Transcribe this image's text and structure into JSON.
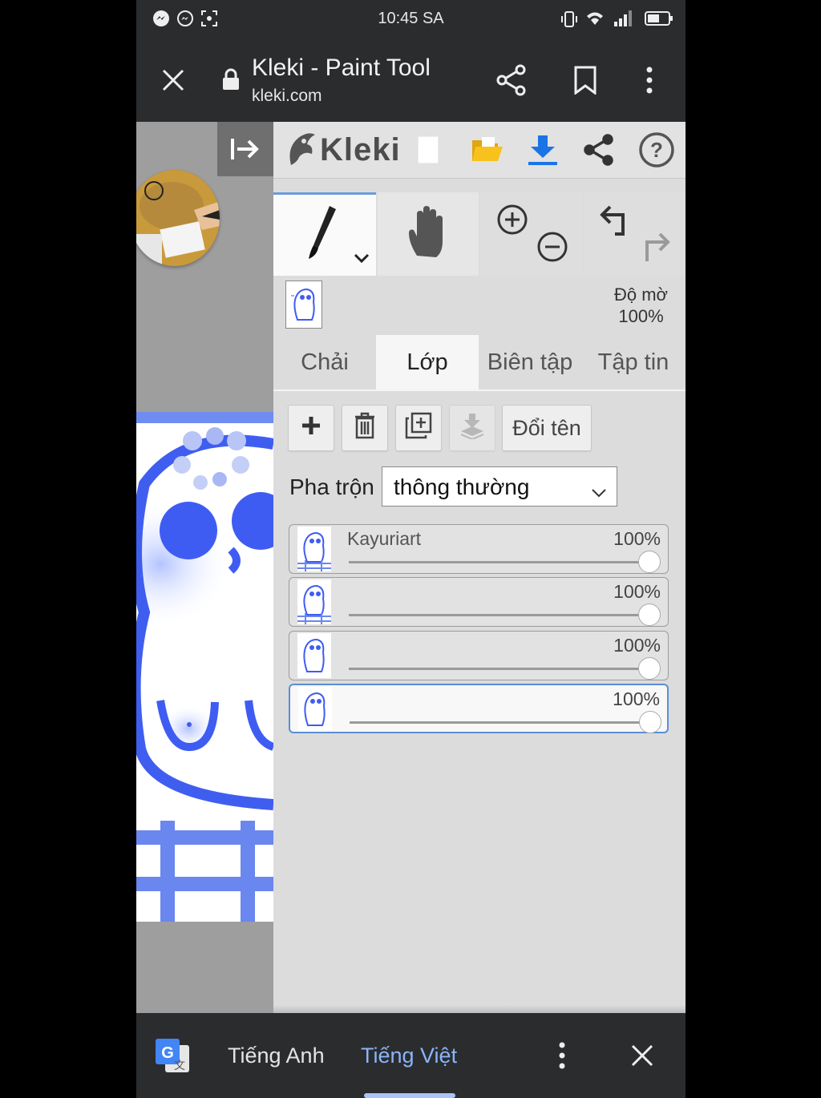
{
  "status_bar": {
    "time": "10:45 SA",
    "left_icons": [
      "messenger-icon",
      "messenger-icon",
      "screenshot-icon"
    ],
    "right_icons": [
      "vibrate-icon",
      "wifi-icon",
      "signal-icon",
      "battery-icon"
    ]
  },
  "browser": {
    "title": "Kleki - Paint Tool",
    "url": "kleki.com",
    "icons": [
      "close-icon",
      "lock-icon",
      "share-icon",
      "bookmark-icon",
      "more-icon"
    ]
  },
  "app": {
    "logo_text": "Kleki",
    "toolbar_icons": [
      "collapse-icon",
      "new-image-icon",
      "open-folder-icon",
      "download-icon",
      "share-icon",
      "help-icon"
    ],
    "tools": {
      "brush_icon": "brush-icon",
      "hand_icon": "hand-icon",
      "zoom_in": "zoom-in-icon",
      "zoom_out": "zoom-out-icon",
      "undo": "undo-icon",
      "redo": "redo-icon"
    },
    "opacity_label": "Độ mờ",
    "opacity_value": "100%",
    "tabs": [
      {
        "label": "Chải",
        "active": false
      },
      {
        "label": "Lớp",
        "active": true
      },
      {
        "label": "Biên tập",
        "active": false
      },
      {
        "label": "Tập tin",
        "active": false
      }
    ],
    "layer_buttons": {
      "add_icon": "plus-icon",
      "delete_icon": "trash-icon",
      "duplicate_icon": "duplicate-icon",
      "merge_icon": "merge-down-icon",
      "rename_label": "Đổi tên"
    },
    "blend_label": "Pha trộn",
    "blend_value": "thông thường",
    "layers": [
      {
        "name": "Kayuriart",
        "opacity": "100%",
        "opacity_fraction": 1.0,
        "selected": false
      },
      {
        "name": "",
        "opacity": "100%",
        "opacity_fraction": 1.0,
        "selected": false
      },
      {
        "name": "",
        "opacity": "100%",
        "opacity_fraction": 1.0,
        "selected": false
      },
      {
        "name": "",
        "opacity": "100%",
        "opacity_fraction": 1.0,
        "selected": true
      }
    ]
  },
  "translate_bar": {
    "icon": "google-translate-icon",
    "source_lang": "Tiếng Anh",
    "target_lang": "Tiếng Việt",
    "accent_color": "#8ab4f8",
    "icons": [
      "more-icon",
      "close-icon"
    ]
  }
}
